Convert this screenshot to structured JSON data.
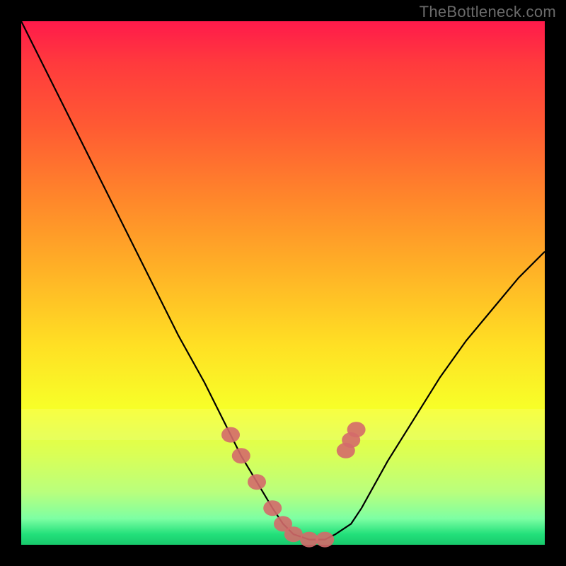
{
  "attribution": "TheBottleneck.com",
  "chart_data": {
    "type": "line",
    "title": "",
    "xlabel": "",
    "ylabel": "",
    "xlim": [
      0,
      100
    ],
    "ylim": [
      0,
      100
    ],
    "grid": false,
    "series": [
      {
        "name": "curve",
        "x": [
          0,
          5,
          10,
          15,
          20,
          25,
          30,
          35,
          40,
          42,
          45,
          48,
          50,
          52,
          55,
          58,
          60,
          63,
          65,
          70,
          75,
          80,
          85,
          90,
          95,
          100
        ],
        "values": [
          100,
          90,
          80,
          70,
          60,
          50,
          40,
          31,
          21,
          17,
          12,
          7,
          4,
          2,
          1,
          1,
          2,
          4,
          7,
          16,
          24,
          32,
          39,
          45,
          51,
          56
        ]
      }
    ],
    "markers": {
      "name": "highlighted-points",
      "x": [
        40,
        42,
        45,
        48,
        50,
        52,
        55,
        58,
        62,
        63,
        64
      ],
      "values": [
        21,
        17,
        12,
        7,
        4,
        2,
        1,
        1,
        18,
        20,
        22
      ],
      "color": "#d46a6a"
    },
    "bands": [
      {
        "y_from": 20,
        "y_to": 26,
        "opacity": 0.35
      }
    ]
  }
}
